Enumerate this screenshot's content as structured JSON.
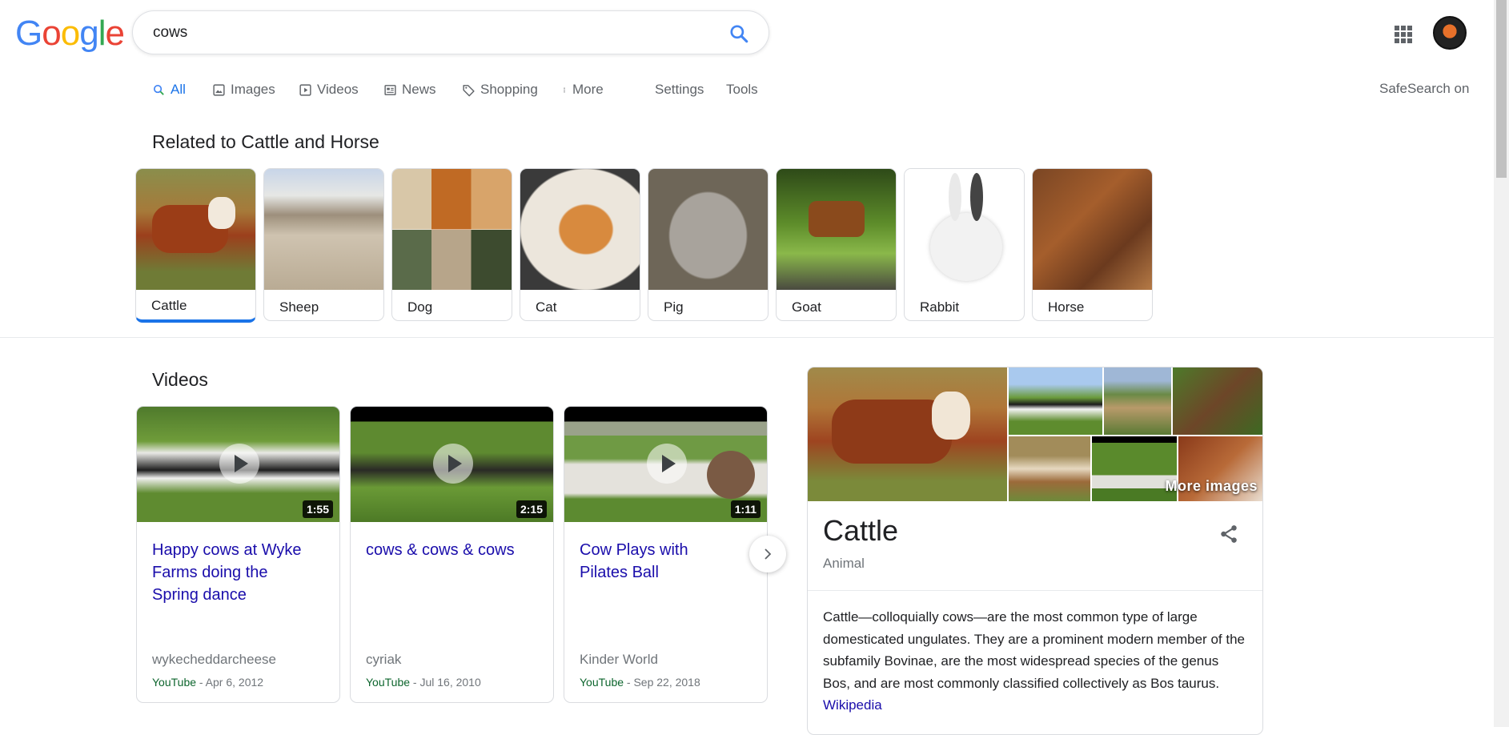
{
  "logo": {
    "letters": [
      "G",
      "o",
      "o",
      "g",
      "l",
      "e"
    ],
    "colors": [
      "#4285f4",
      "#ea4335",
      "#fbbc05",
      "#4285f4",
      "#34a853",
      "#ea4335"
    ]
  },
  "search": {
    "query": "cows"
  },
  "tabs": [
    {
      "label": "All",
      "icon": "search-icon"
    },
    {
      "label": "Images",
      "icon": "image-icon"
    },
    {
      "label": "Videos",
      "icon": "video-icon"
    },
    {
      "label": "News",
      "icon": "news-icon"
    },
    {
      "label": "Shopping",
      "icon": "tag-icon"
    },
    {
      "label": "More",
      "icon": "dots-vertical-icon"
    },
    {
      "label": "Settings"
    },
    {
      "label": "Tools"
    }
  ],
  "safesearch": "SafeSearch on",
  "related": {
    "title": "Related to Cattle and Horse",
    "items": [
      "Cattle",
      "Sheep",
      "Dog",
      "Cat",
      "Pig",
      "Goat",
      "Rabbit",
      "Horse"
    ]
  },
  "videos": {
    "title": "Videos",
    "items": [
      {
        "title": "Happy cows at Wyke Farms doing the Spring dance",
        "duration": "1:55",
        "channel": "wykecheddarcheese",
        "source": "YouTube",
        "date": " - Apr 6, 2012"
      },
      {
        "title": "cows & cows & cows",
        "duration": "2:15",
        "channel": "cyriak",
        "source": "YouTube",
        "date": " - Jul 16, 2010"
      },
      {
        "title": "Cow Plays with Pilates Ball",
        "duration": "1:11",
        "channel": "Kinder World",
        "source": "YouTube",
        "date": " - Sep 22, 2018"
      }
    ]
  },
  "knowledge": {
    "more_images": "More images",
    "title": "Cattle",
    "subtitle": "Animal",
    "description": "Cattle—colloquially cows—are the most common type of large domesticated ungulates. They are a prominent modern member of the subfamily Bovinae, are the most widespread species of the genus Bos, and are most commonly classified collectively as Bos taurus.",
    "link": "Wikipedia"
  }
}
